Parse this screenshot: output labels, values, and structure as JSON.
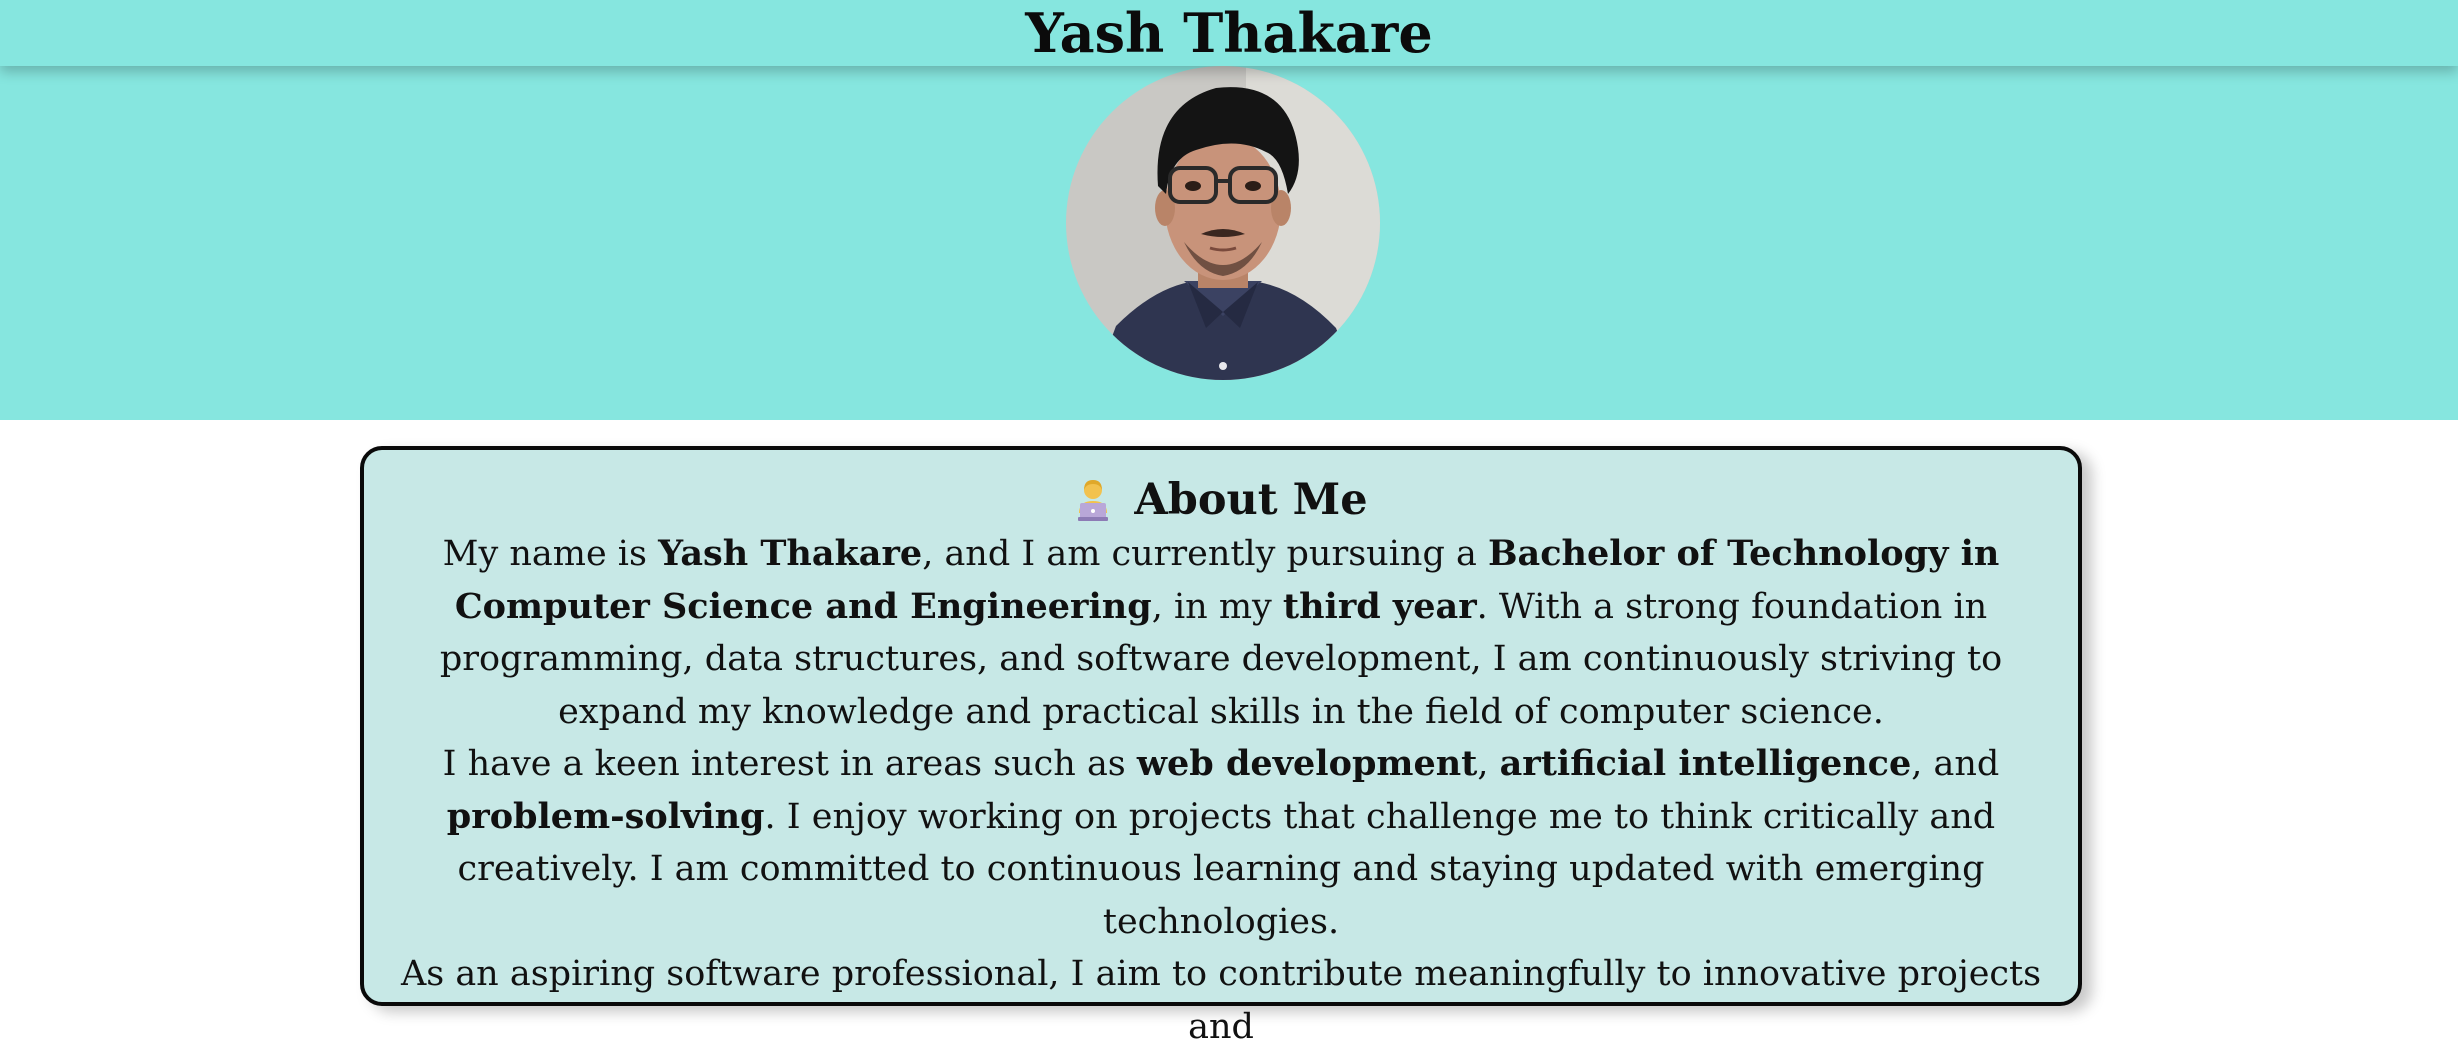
{
  "header": {
    "title": "Yash Thakare"
  },
  "profile": {
    "photo_icon": "profile-photo",
    "theme_color": "#86e6df"
  },
  "about": {
    "icon": "technologist-emoji",
    "heading": "About Me",
    "card_color": "#c7e8e6",
    "paragraph1": {
      "t1": "My name is ",
      "b1": "Yash Thakare",
      "t2": ", and I am currently pursuing a ",
      "b2": "Bachelor of Technology in Computer Science and Engineering",
      "t3": ", in my ",
      "b3": "third year",
      "t4": ". With a strong foundation in programming, data structures, and software development, I am continuously striving to expand my knowledge and practical skills in the field of computer science."
    },
    "paragraph2": {
      "t1": "I have a keen interest in areas such as ",
      "b1": "web development",
      "t2": ", ",
      "b2": "artificial intelligence",
      "t3": ", and ",
      "b3": "problem-solving",
      "t4": ". I enjoy working on projects that challenge me to think critically and creatively. I am committed to continuous learning and staying updated with emerging technologies."
    },
    "paragraph3": {
      "t1": "As an aspiring software professional, I aim to contribute meaningfully to innovative projects and"
    }
  }
}
